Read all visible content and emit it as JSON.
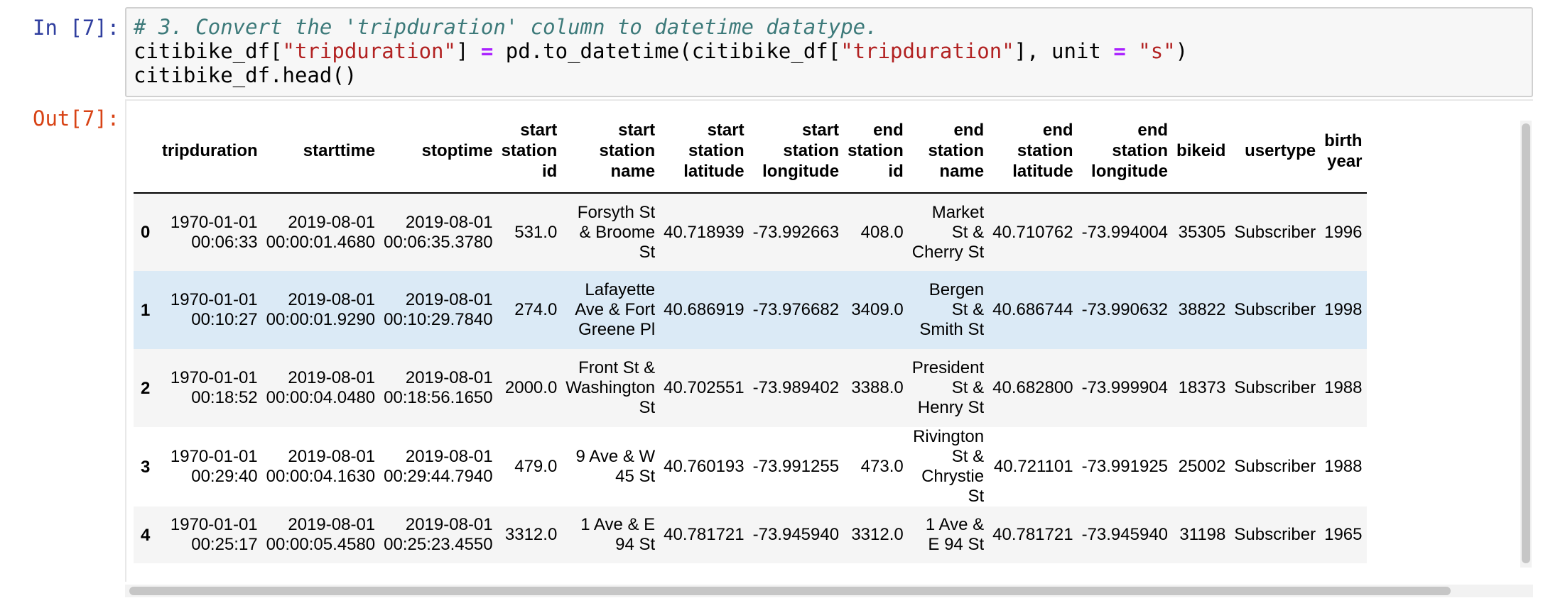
{
  "cell": {
    "in_prompt": "In [7]:",
    "out_prompt": "Out[7]:",
    "code": {
      "comment": "# 3. Convert the 'tripduration' column to datetime datatype.",
      "line2": {
        "p1": "citibike_df[",
        "s1": "\"tripduration\"",
        "p2": "] ",
        "op1": "=",
        "p3": " pd.to_datetime(citibike_df[",
        "s2": "\"tripduration\"",
        "p4": "], unit ",
        "op2": "=",
        "p5": " ",
        "s3": "\"s\"",
        "p6": ")"
      },
      "line3": "citibike_df.head()"
    }
  },
  "table": {
    "columns": [
      "",
      "tripduration",
      "starttime",
      "stoptime",
      "start station id",
      "start station name",
      "start station latitude",
      "start station longitude",
      "end station id",
      "end station name",
      "end station latitude",
      "end station longitude",
      "bikeid",
      "usertype",
      "birth year"
    ],
    "rows": [
      {
        "index": "0",
        "cells": [
          "1970-01-01 00:06:33",
          "2019-08-01 00:00:01.4680",
          "2019-08-01 00:06:35.3780",
          "531.0",
          "Forsyth St & Broome St",
          "40.718939",
          "-73.992663",
          "408.0",
          "Market St & Cherry St",
          "40.710762",
          "-73.994004",
          "35305",
          "Subscriber",
          "1996"
        ]
      },
      {
        "index": "1",
        "cells": [
          "1970-01-01 00:10:27",
          "2019-08-01 00:00:01.9290",
          "2019-08-01 00:10:29.7840",
          "274.0",
          "Lafayette Ave & Fort Greene Pl",
          "40.686919",
          "-73.976682",
          "3409.0",
          "Bergen St & Smith St",
          "40.686744",
          "-73.990632",
          "38822",
          "Subscriber",
          "1998"
        ]
      },
      {
        "index": "2",
        "cells": [
          "1970-01-01 00:18:52",
          "2019-08-01 00:00:04.0480",
          "2019-08-01 00:18:56.1650",
          "2000.0",
          "Front St & Washington St",
          "40.702551",
          "-73.989402",
          "3388.0",
          "President St & Henry St",
          "40.682800",
          "-73.999904",
          "18373",
          "Subscriber",
          "1988"
        ]
      },
      {
        "index": "3",
        "cells": [
          "1970-01-01 00:29:40",
          "2019-08-01 00:00:04.1630",
          "2019-08-01 00:29:44.7940",
          "479.0",
          "9 Ave & W 45 St",
          "40.760193",
          "-73.991255",
          "473.0",
          "Rivington St & Chrystie St",
          "40.721101",
          "-73.991925",
          "25002",
          "Subscriber",
          "1988"
        ]
      },
      {
        "index": "4",
        "cells": [
          "1970-01-01 00:25:17",
          "2019-08-01 00:00:05.4580",
          "2019-08-01 00:25:23.4550",
          "3312.0",
          "1 Ave & E 94 St",
          "40.781721",
          "-73.945940",
          "3312.0",
          "1 Ave & E 94 St",
          "40.781721",
          "-73.945940",
          "31198",
          "Subscriber",
          "1965"
        ]
      }
    ]
  }
}
